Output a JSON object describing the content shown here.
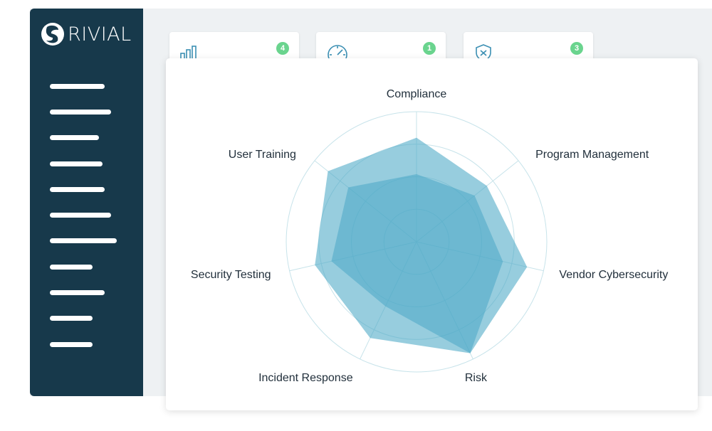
{
  "brand": {
    "name": "RIVIAL"
  },
  "sidebar": {
    "items": [
      {
        "icon": "menu-line"
      },
      {
        "icon": "menu-line"
      },
      {
        "icon": "menu-line"
      },
      {
        "icon": "menu-line"
      },
      {
        "icon": "menu-line"
      },
      {
        "icon": "menu-line"
      },
      {
        "icon": "menu-line"
      },
      {
        "icon": "menu-line"
      },
      {
        "icon": "menu-line"
      },
      {
        "icon": "menu-line"
      },
      {
        "icon": "menu-line"
      }
    ]
  },
  "stat_cards": [
    {
      "icon": "bar-chart-icon",
      "count": "4"
    },
    {
      "icon": "gauge-icon",
      "count": "1"
    },
    {
      "icon": "shield-x-icon",
      "count": "3"
    }
  ],
  "colors": {
    "sidebar": "#17394b",
    "badge": "#6ad48e",
    "accent": "#4ba8c7"
  },
  "chart_data": {
    "type": "radar",
    "axes": [
      "Compliance",
      "Program Management",
      "Vendor Cybersecurity",
      "Risk",
      "Incident Response",
      "Security Testing",
      "User Training"
    ],
    "rmax": 100,
    "rings": [
      25,
      50,
      75,
      100
    ],
    "series": [
      {
        "values": [
          80,
          69,
          87,
          95,
          82,
          80,
          87
        ]
      },
      {
        "values": [
          52,
          57,
          68,
          95,
          55,
          67,
          67
        ]
      }
    ]
  }
}
